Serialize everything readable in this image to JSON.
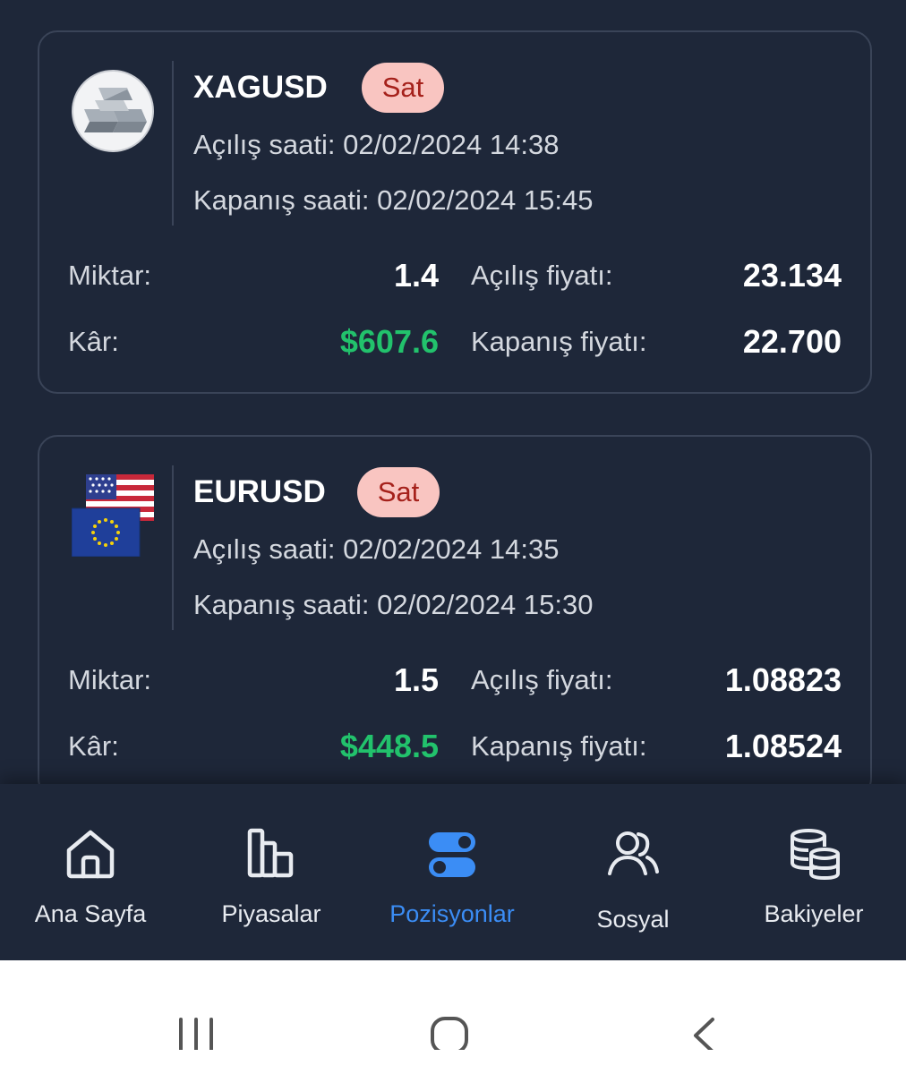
{
  "positions": [
    {
      "symbol": "XAGUSD",
      "side": "Sat",
      "logo_icon": "silver-bars-icon",
      "open_time_label": "Açılış saati:",
      "open_time": "02/02/2024 14:38",
      "close_time_label": "Kapanış saati:",
      "close_time": "02/02/2024 15:45",
      "amount_label": "Miktar:",
      "amount": "1.4",
      "profit_label": "Kâr:",
      "profit": "$607.6",
      "open_price_label": "Açılış fiyatı:",
      "open_price": "23.134",
      "close_price_label": "Kapanış fiyatı:",
      "close_price": "22.700"
    },
    {
      "symbol": "EURUSD",
      "side": "Sat",
      "logo_icon": "eur-usd-flags-icon",
      "open_time_label": "Açılış saati:",
      "open_time": "02/02/2024 14:35",
      "close_time_label": "Kapanış saati:",
      "close_time": "02/02/2024 15:30",
      "amount_label": "Miktar:",
      "amount": "1.5",
      "profit_label": "Kâr:",
      "profit": "$448.5",
      "open_price_label": "Açılış fiyatı:",
      "open_price": "1.08823",
      "close_price_label": "Kapanış fiyatı:",
      "close_price": "1.08524"
    }
  ],
  "nav": {
    "items": [
      {
        "label": "Ana Sayfa",
        "icon": "home-icon",
        "active": false
      },
      {
        "label": "Piyasalar",
        "icon": "bar-chart-icon",
        "active": false
      },
      {
        "label": "Pozisyonlar",
        "icon": "toggles-icon",
        "active": true
      },
      {
        "label": "Sosyal",
        "icon": "users-icon",
        "active": false
      },
      {
        "label": "Bakiyeler",
        "icon": "coins-icon",
        "active": false
      }
    ]
  },
  "colors": {
    "background": "#1e2739",
    "profit": "#22c26c",
    "badge_bg": "#f9c5c1",
    "badge_text": "#a5211b",
    "active_nav": "#3b8df5"
  },
  "system_nav": [
    "recent-apps-icon",
    "home-circle-icon",
    "back-icon"
  ]
}
